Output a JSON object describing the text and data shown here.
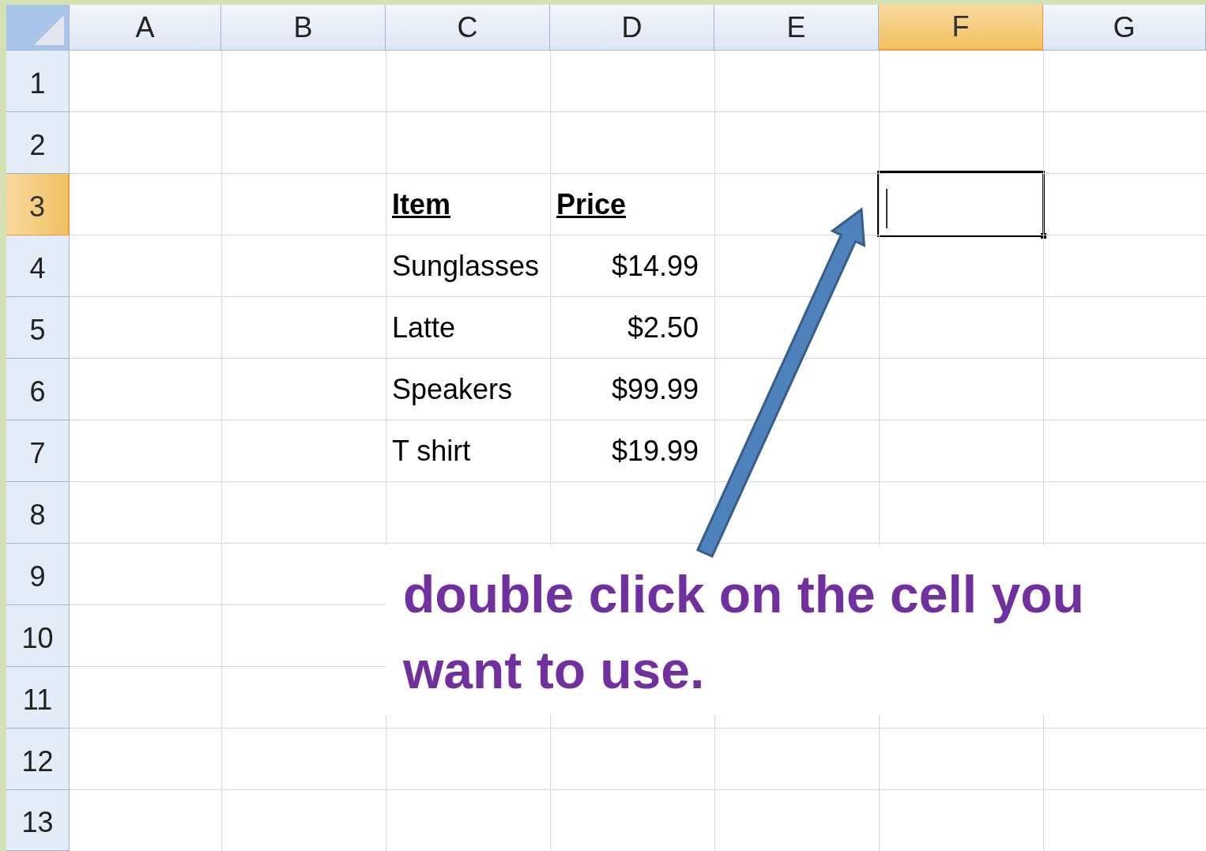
{
  "columns": [
    {
      "label": "A",
      "selected": false
    },
    {
      "label": "B",
      "selected": false
    },
    {
      "label": "C",
      "selected": false
    },
    {
      "label": "D",
      "selected": false
    },
    {
      "label": "E",
      "selected": false
    },
    {
      "label": "F",
      "selected": true
    },
    {
      "label": "G",
      "selected": false
    }
  ],
  "rows": [
    {
      "label": "1",
      "selected": false
    },
    {
      "label": "2",
      "selected": false
    },
    {
      "label": "3",
      "selected": true,
      "cells": [
        {
          "kind": "blank"
        },
        {
          "kind": "blank"
        },
        {
          "kind": "header",
          "text": "Item"
        },
        {
          "kind": "header",
          "text": "Price"
        },
        {
          "kind": "blank"
        },
        {
          "kind": "blank",
          "active": true,
          "editing": true
        },
        {
          "kind": "blank"
        }
      ]
    },
    {
      "label": "4",
      "selected": false,
      "cells": [
        {
          "kind": "blank"
        },
        {
          "kind": "blank"
        },
        {
          "kind": "text",
          "text": "Sunglasses"
        },
        {
          "kind": "number",
          "text": "$14.99"
        }
      ]
    },
    {
      "label": "5",
      "selected": false,
      "cells": [
        {
          "kind": "blank"
        },
        {
          "kind": "blank"
        },
        {
          "kind": "text",
          "text": "Latte"
        },
        {
          "kind": "number",
          "text": "$2.50"
        }
      ]
    },
    {
      "label": "6",
      "selected": false,
      "cells": [
        {
          "kind": "blank"
        },
        {
          "kind": "blank"
        },
        {
          "kind": "text",
          "text": "Speakers"
        },
        {
          "kind": "number",
          "text": "$99.99"
        }
      ]
    },
    {
      "label": "7",
      "selected": false,
      "cells": [
        {
          "kind": "blank"
        },
        {
          "kind": "blank"
        },
        {
          "kind": "text",
          "text": "T shirt"
        },
        {
          "kind": "number",
          "text": "$19.99"
        }
      ]
    },
    {
      "label": "8",
      "selected": false
    },
    {
      "label": "9",
      "selected": false
    },
    {
      "label": "10",
      "selected": false
    },
    {
      "label": "11",
      "selected": false
    },
    {
      "label": "12",
      "selected": false
    },
    {
      "label": "13",
      "selected": false
    }
  ],
  "annotation": {
    "text": "double click on the cell you want to use."
  }
}
